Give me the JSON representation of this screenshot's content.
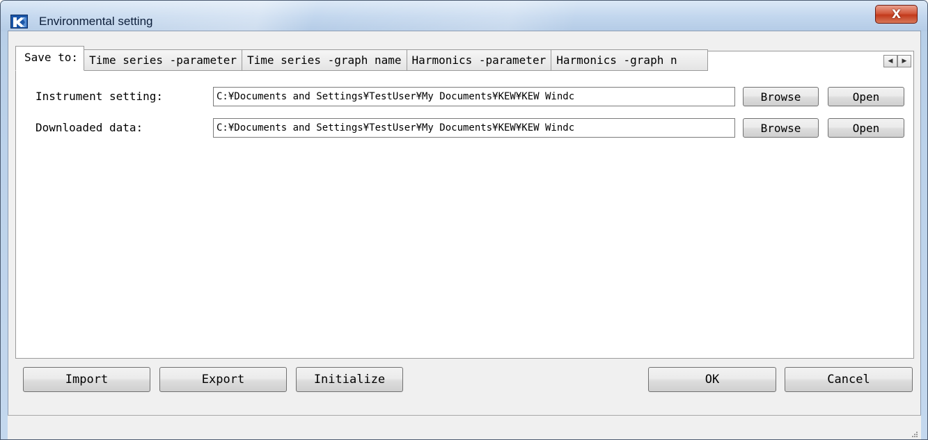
{
  "window": {
    "title": "Environmental setting",
    "close_label": "X"
  },
  "tabs": [
    {
      "label": "Save to:",
      "active": true
    },
    {
      "label": "Time series -parameter",
      "active": false
    },
    {
      "label": "Time series -graph name",
      "active": false
    },
    {
      "label": "Harmonics -parameter",
      "active": false
    },
    {
      "label": "Harmonics -graph n",
      "active": false
    }
  ],
  "tab_scroller": {
    "left_icon": "scroll-left-arrow",
    "right_icon": "scroll-right-arrow",
    "left_glyph": "◀",
    "right_glyph": "▶"
  },
  "save_to": {
    "instrument_setting": {
      "label": "Instrument setting:",
      "value": "C:¥Documents and Settings¥TestUser¥My Documents¥KEW¥KEW Windc",
      "browse_label": "Browse",
      "open_label": "Open"
    },
    "downloaded_data": {
      "label": "Downloaded data:",
      "value": "C:¥Documents and Settings¥TestUser¥My Documents¥KEW¥KEW Windc",
      "browse_label": "Browse",
      "open_label": "Open"
    }
  },
  "buttons": {
    "import_label": "Import",
    "export_label": "Export",
    "initialize_label": "Initialize",
    "ok_label": "OK",
    "cancel_label": "Cancel"
  },
  "colors": {
    "close_button": "#c94a2c",
    "app_icon": "#1a56a8"
  }
}
